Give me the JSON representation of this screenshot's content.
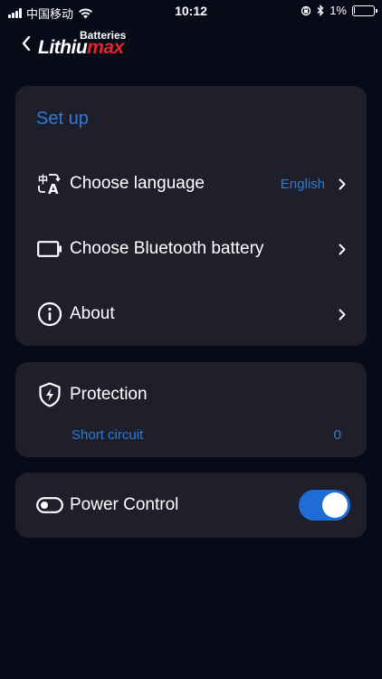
{
  "status_bar": {
    "carrier": "中国移动",
    "time": "10:12",
    "battery_percent": "1%",
    "battery_level": 0.01,
    "icons": [
      "signal-icon",
      "wifi-icon",
      "orientation-lock-icon",
      "bluetooth-icon",
      "battery-icon"
    ]
  },
  "header": {
    "back_icon": "chevron-left-icon",
    "logo_sub": "Batteries",
    "logo_main_part1": "Lithiu",
    "logo_main_part2": "max"
  },
  "setup": {
    "title": "Set up",
    "items": [
      {
        "icon": "language-icon",
        "label": "Choose language",
        "value": "English"
      },
      {
        "icon": "battery-outline-icon",
        "label": "Choose Bluetooth battery",
        "value": ""
      },
      {
        "icon": "info-icon",
        "label": "About",
        "value": ""
      }
    ]
  },
  "protection": {
    "icon": "shield-bolt-icon",
    "title": "Protection",
    "item_label": "Short circuit",
    "item_value": "0"
  },
  "power": {
    "icon": "toggle-icon",
    "title": "Power Control",
    "enabled": true
  },
  "colors": {
    "background": "#090a18",
    "card": "#1f1f2c",
    "accent": "#2e7bd6",
    "toggle_on": "#1e6cd6",
    "logo_red": "#e0262e"
  }
}
